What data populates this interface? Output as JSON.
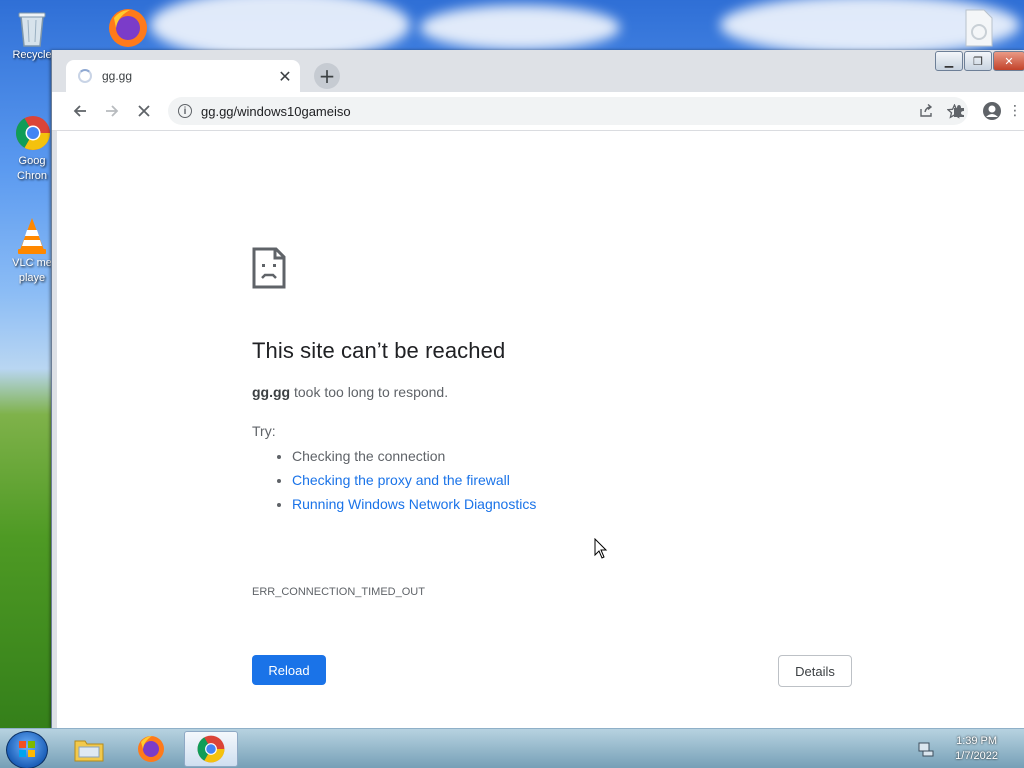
{
  "desktop": {
    "icons": [
      {
        "label": "Recycle"
      },
      {
        "label": "Goog\nChron"
      },
      {
        "label": "VLC me\nplaye"
      }
    ]
  },
  "browser": {
    "tab": {
      "title": "gg.gg"
    },
    "omnibox": {
      "url": "gg.gg/windows10gameiso"
    }
  },
  "error_page": {
    "title": "This site can’t be reached",
    "host": "gg.gg",
    "description_suffix": " took too long to respond.",
    "try_label": "Try:",
    "suggestions": [
      {
        "text": "Checking the connection"
      },
      {
        "text": "Checking the proxy and the firewall"
      },
      {
        "text": "Running Windows Network Diagnostics"
      }
    ],
    "error_code": "ERR_CONNECTION_TIMED_OUT",
    "reload_label": "Reload",
    "details_label": "Details"
  },
  "taskbar": {
    "apps": [
      "file-explorer",
      "firefox",
      "chrome"
    ],
    "active_app": "chrome",
    "time": "1:39 PM",
    "date": "1/7/2022"
  },
  "colors": {
    "link": "#1a73e8",
    "primary_button": "#1a73e8",
    "text_secondary": "#5f6368",
    "title": "#202124"
  }
}
